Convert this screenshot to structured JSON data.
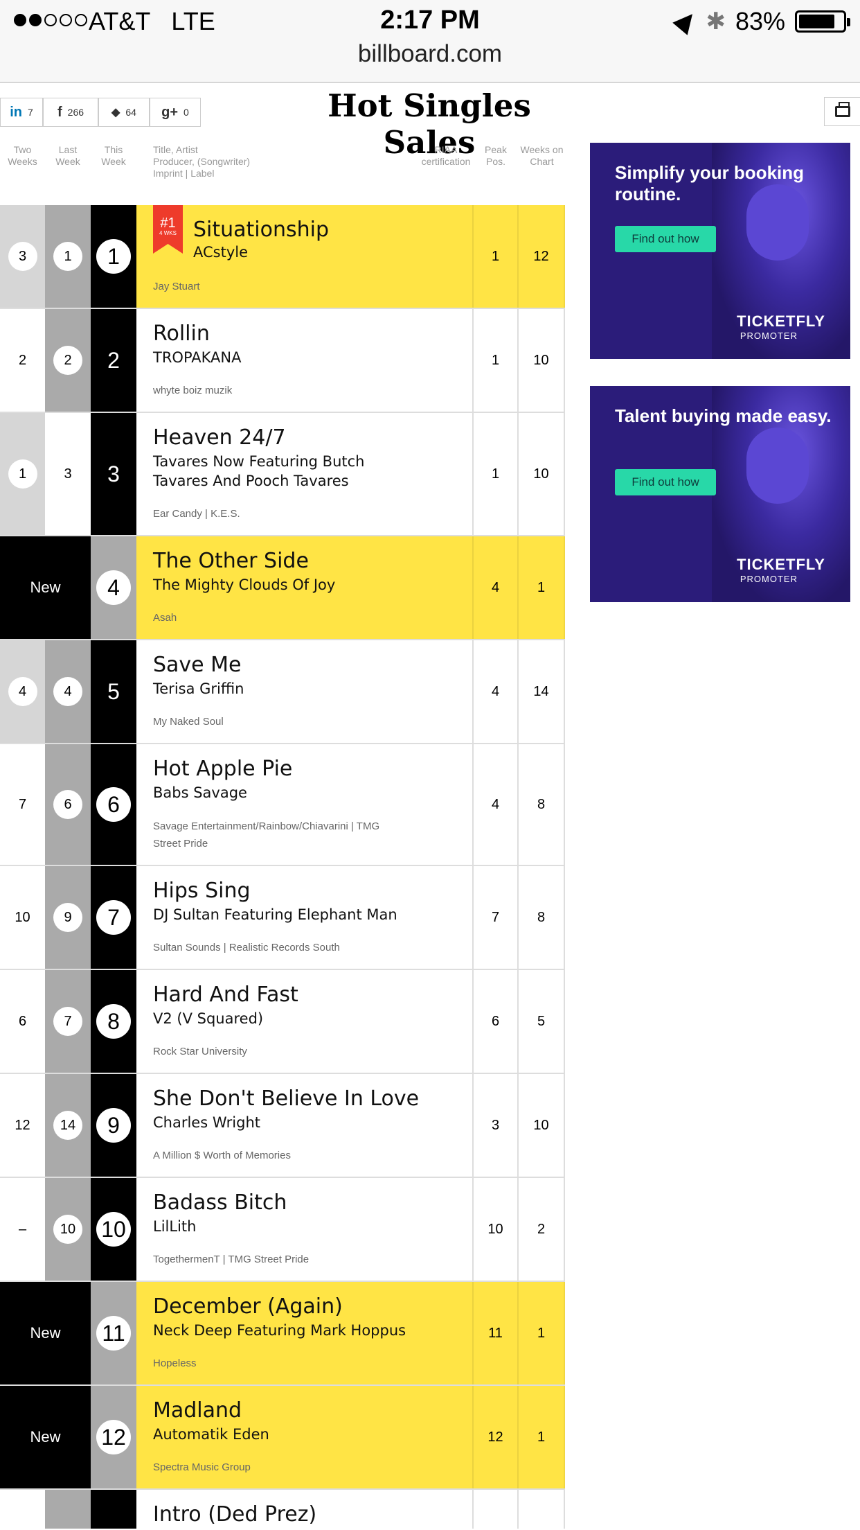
{
  "status_bar": {
    "carrier": "AT&T",
    "network": "LTE",
    "time": "2:17 PM",
    "battery": "83%",
    "battery_level": 0.83,
    "signal_bars_filled": 2,
    "signal_bars_total": 5
  },
  "browser": {
    "url": "billboard.com"
  },
  "share": [
    {
      "icon": "linkedin-icon",
      "glyph": "in",
      "count": "7"
    },
    {
      "icon": "facebook-icon",
      "glyph": "f",
      "count": "266"
    },
    {
      "icon": "twitter-icon",
      "glyph": "🐦",
      "count": "64"
    },
    {
      "icon": "google-plus-icon",
      "glyph": "g+",
      "count": "0"
    }
  ],
  "page_title": "Hot Singles Sales",
  "columns": {
    "two_weeks": "Two Weeks",
    "last_week": "Last Week",
    "this_week": "This Week",
    "title_line1": "Title, Artist",
    "title_line2": "Producer, (Songwriter)",
    "title_line3": "Imprint | Label",
    "riaa": "RIAA certification",
    "peak": "Peak Pos.",
    "weeks": "Weeks on Chart"
  },
  "chart": [
    {
      "two": "3",
      "last": "1",
      "this": "1",
      "title": "Situationship",
      "artist": "ACstyle",
      "label": "Jay Stuart",
      "peak": "1",
      "weeks": "12",
      "highlight": true,
      "badge": {
        "num": "#1",
        "weeks": "4 WKS"
      }
    },
    {
      "two": "2",
      "last": "2",
      "this": "2",
      "title": "Rollin",
      "artist": "TROPAKANA",
      "label": "whyte boiz muzik",
      "peak": "1",
      "weeks": "10",
      "highlight": false
    },
    {
      "two": "1",
      "last": "3",
      "this": "3",
      "title": "Heaven 24/7",
      "artist": "Tavares Now Featuring Butch Tavares And Pooch Tavares",
      "label": "Ear Candy | K.E.S.",
      "peak": "1",
      "weeks": "10",
      "highlight": false
    },
    {
      "new_label": "New",
      "this": "4",
      "title": "The Other Side",
      "artist": "The Mighty Clouds Of Joy",
      "label": "Asah",
      "peak": "4",
      "weeks": "1",
      "highlight": true
    },
    {
      "two": "4",
      "last": "4",
      "this": "5",
      "title": "Save Me",
      "artist": "Terisa Griffin",
      "label": "My Naked Soul",
      "peak": "4",
      "weeks": "14",
      "highlight": false
    },
    {
      "two": "7",
      "last": "6",
      "this": "6",
      "title": "Hot Apple Pie",
      "artist": "Babs Savage",
      "label": "Savage Entertainment/Rainbow/Chiavarini | TMG Street Pride",
      "peak": "4",
      "weeks": "8",
      "highlight": false
    },
    {
      "two": "10",
      "last": "9",
      "this": "7",
      "title": "Hips Sing",
      "artist": "DJ Sultan Featuring Elephant Man",
      "label": "Sultan Sounds | Realistic Records South",
      "peak": "7",
      "weeks": "8",
      "highlight": false
    },
    {
      "two": "6",
      "last": "7",
      "this": "8",
      "title": "Hard And Fast",
      "artist": "V2 (V Squared)",
      "label": "Rock Star University",
      "peak": "6",
      "weeks": "5",
      "highlight": false
    },
    {
      "two": "12",
      "last": "14",
      "this": "9",
      "title": "She Don't Believe In Love",
      "artist": "Charles Wright",
      "label": "A Million $ Worth of Memories",
      "peak": "3",
      "weeks": "10",
      "highlight": false
    },
    {
      "two": "–",
      "last": "10",
      "this": "10",
      "title": "Badass Bitch",
      "artist": "LilLith",
      "label": "TogethermenT | TMG Street Pride",
      "peak": "10",
      "weeks": "2",
      "highlight": false
    },
    {
      "new_label": "New",
      "this": "11",
      "title": "December (Again)",
      "artist": "Neck Deep Featuring Mark Hoppus",
      "label": "Hopeless",
      "peak": "11",
      "weeks": "1",
      "highlight": true
    },
    {
      "new_label": "New",
      "this": "12",
      "title": "Madland",
      "artist": "Automatik Eden",
      "label": "Spectra Music Group",
      "peak": "12",
      "weeks": "1",
      "highlight": true
    },
    {
      "title": "Intro (Ded Prez)",
      "highlight": false
    }
  ],
  "ads": [
    {
      "headline": "Simplify your booking routine.",
      "button": "Find out how",
      "brand": "TICKETFLY",
      "sub": "PROMOTER"
    },
    {
      "headline": "Talent buying made easy.",
      "button": "Find out how",
      "brand": "TICKETFLY",
      "sub": "PROMOTER"
    }
  ],
  "colors": {
    "highlight": "#ffe445",
    "badge": "#ee3b2b",
    "ad_bg": "#2b1c7a",
    "ad_button": "#28d8a8"
  }
}
